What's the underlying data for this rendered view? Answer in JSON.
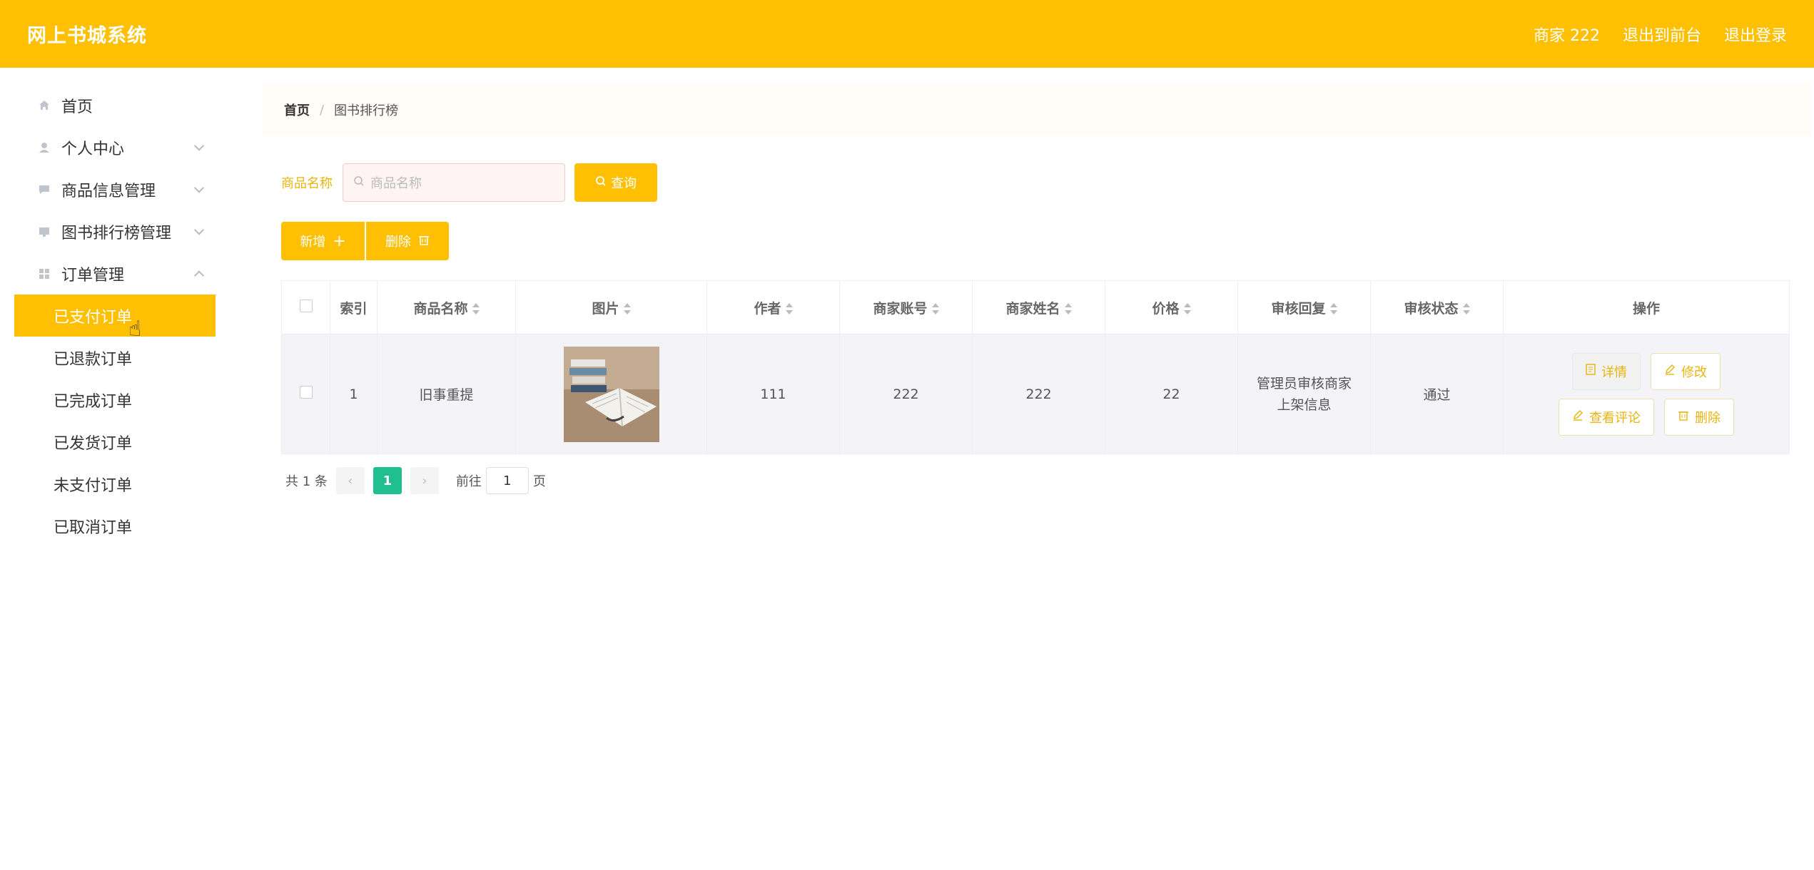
{
  "header": {
    "brand": "网上书城系统",
    "user": "商家 222",
    "to_front": "退出到前台",
    "logout": "退出登录"
  },
  "sidebar": {
    "items": [
      {
        "label": "首页",
        "icon": "home-icon"
      },
      {
        "label": "个人中心",
        "icon": "user-icon"
      },
      {
        "label": "商品信息管理",
        "icon": "message-icon"
      },
      {
        "label": "图书排行榜管理",
        "icon": "monitor-icon"
      },
      {
        "label": "订单管理",
        "icon": "grid-icon"
      }
    ],
    "order_sub": [
      {
        "label": "已支付订单",
        "active": true
      },
      {
        "label": "已退款订单"
      },
      {
        "label": "已完成订单"
      },
      {
        "label": "已发货订单"
      },
      {
        "label": "未支付订单"
      },
      {
        "label": "已取消订单"
      }
    ]
  },
  "breadcrumb": {
    "home": "首页",
    "sep": "/",
    "current": "图书排行榜"
  },
  "search": {
    "label": "商品名称",
    "placeholder": "商品名称",
    "button": "查询"
  },
  "actions": {
    "add": "新增",
    "delete": "删除"
  },
  "table": {
    "headers": [
      "索引",
      "商品名称",
      "图片",
      "作者",
      "商家账号",
      "商家姓名",
      "价格",
      "审核回复",
      "审核状态",
      "操作"
    ],
    "rows": [
      {
        "index": "1",
        "name": "旧事重提",
        "author": "111",
        "merchant_account": "222",
        "merchant_name": "222",
        "price": "22",
        "review_reply": "管理员审核商家上架信息",
        "review_status": "通过"
      }
    ],
    "ops": {
      "detail": "详情",
      "edit": "修改",
      "comments": "查看评论",
      "delete": "删除"
    }
  },
  "pagination": {
    "total": "共 1 条",
    "current": "1",
    "goto_prefix": "前往",
    "goto_value": "1",
    "goto_suffix": "页"
  },
  "colors": {
    "accent": "#ffc004",
    "pager_active": "#1fbf8f"
  }
}
